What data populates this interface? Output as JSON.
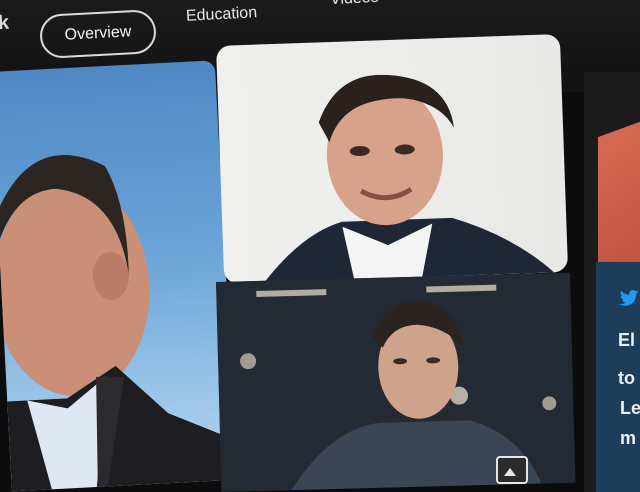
{
  "nav": {
    "partial_label": "k",
    "tabs": [
      {
        "label": "Overview",
        "active": true
      },
      {
        "label": "Education",
        "active": false
      },
      {
        "label": "Videos",
        "active": false
      }
    ]
  },
  "gallery": {
    "images": [
      {
        "name": "portrait-left"
      },
      {
        "name": "portrait-top-center"
      },
      {
        "name": "portrait-bottom-center"
      }
    ]
  },
  "right_card": {
    "icon": "twitter-icon",
    "text_lines": [
      "El",
      "to",
      "Le",
      "m"
    ]
  },
  "colors": {
    "bg": "#0c0c0c",
    "tab_border": "#dcdcdc",
    "twitter_blue": "#1d9bf0"
  }
}
